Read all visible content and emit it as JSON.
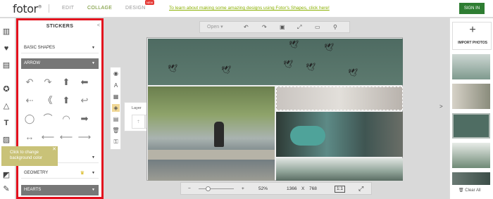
{
  "header": {
    "logo": "fotor",
    "logo_mark": "®",
    "nav": [
      "EDIT",
      "COLLAGE",
      "DESIGN"
    ],
    "new_badge": "NEW",
    "promo_link": "To learn about making some amazing designs using Fotor's Shapes, click here!",
    "sign_in": "SIGN IN",
    "accent": "#6b8e23"
  },
  "rail": {
    "icons": [
      "layout-icon",
      "heart-sticker-icon",
      "grid-icon",
      "star-icon",
      "shapes-icon",
      "text-icon",
      "pattern-icon",
      "background-icon",
      "edit-icon"
    ]
  },
  "stickers_panel": {
    "title": "STICKERS",
    "close": "<",
    "dropdowns": [
      {
        "label": "BASIC SHAPES",
        "dark": false
      },
      {
        "label": "ARROW",
        "dark": true
      },
      {
        "label": "",
        "dark": false
      },
      {
        "label": "GEOMETRY",
        "dark": false
      },
      {
        "label": "HEARTS",
        "dark": true
      }
    ],
    "stickers": [
      "↶",
      "↷",
      "⬆",
      "⬅",
      "⇠",
      "《",
      "⬆",
      "↩",
      "◯",
      "⌒",
      "◠",
      "➡",
      "↔",
      "⟵",
      "⟵",
      "⟶"
    ]
  },
  "tooltip": {
    "text": "Click to change background color",
    "close": "✕"
  },
  "tools": {
    "icons": [
      "circle-dot-icon",
      "text-a-icon",
      "grid-icon",
      "layer-icon",
      "document-icon",
      "trash-icon",
      "lock-icon"
    ]
  },
  "layer_popup": {
    "title": "Layer",
    "buttons": [
      "⇡",
      "↑",
      "↓",
      "⇣"
    ]
  },
  "top_toolbar": {
    "open_label": "Open",
    "caret": "▾",
    "icons": [
      "↶",
      "↷",
      "▣",
      "⤢",
      "▭",
      "⚲"
    ]
  },
  "bottom_toolbar": {
    "minus": "−",
    "plus": "+",
    "zoom": "52%",
    "width": "1366",
    "x": "X",
    "height": "768",
    "ratio": "1:1",
    "fit": "⤢",
    "zoom_level": 0.52
  },
  "right_panel": {
    "import_plus": "+",
    "import_label": "IMPORT PHOTOS",
    "clear_all": "Clear All",
    "expander": ">"
  }
}
